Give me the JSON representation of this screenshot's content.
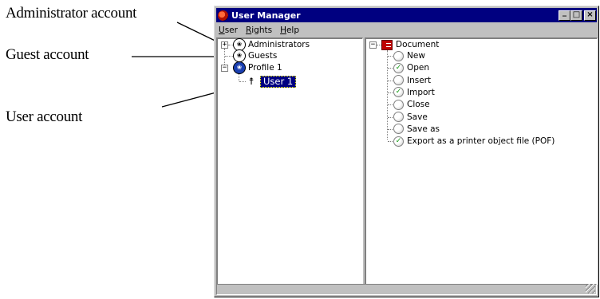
{
  "callouts": {
    "administrator": "Administrator account",
    "guest": "Guest account",
    "user": "User account"
  },
  "window": {
    "title": "User Manager",
    "icon": "app-globe-icon",
    "buttons": {
      "minimize": "_",
      "maximize": "□",
      "close": "×"
    }
  },
  "menu": {
    "items": [
      {
        "label": "User",
        "accel": "U",
        "rest": "ser"
      },
      {
        "label": "Rights",
        "accel": "R",
        "rest": "ights"
      },
      {
        "label": "Help",
        "accel": "H",
        "rest": "elp"
      }
    ]
  },
  "left_tree": {
    "items": [
      {
        "label": "Administrators",
        "expander": "+",
        "icon": "group-icon"
      },
      {
        "label": "Guests",
        "expander": "",
        "icon": "group-icon"
      },
      {
        "label": "Profile 1",
        "expander": "−",
        "icon": "profile-icon"
      },
      {
        "label": "User 1",
        "expander": "",
        "icon": "person-icon",
        "selected": true
      }
    ]
  },
  "right_tree": {
    "root": {
      "label": "Document",
      "expander": "−",
      "icon": "document-icon"
    },
    "rights": [
      {
        "label": "New",
        "checked": false
      },
      {
        "label": "Open",
        "checked": true
      },
      {
        "label": "Insert",
        "checked": false
      },
      {
        "label": "Import",
        "checked": true
      },
      {
        "label": "Close",
        "checked": false
      },
      {
        "label": "Save",
        "checked": false
      },
      {
        "label": "Save as",
        "checked": false
      },
      {
        "label": "Export as a printer object file (POF)",
        "checked": true
      }
    ]
  },
  "colors": {
    "titlebar": "#000080",
    "face": "#c0c0c0",
    "selection": "#000080",
    "check": "#119911"
  }
}
